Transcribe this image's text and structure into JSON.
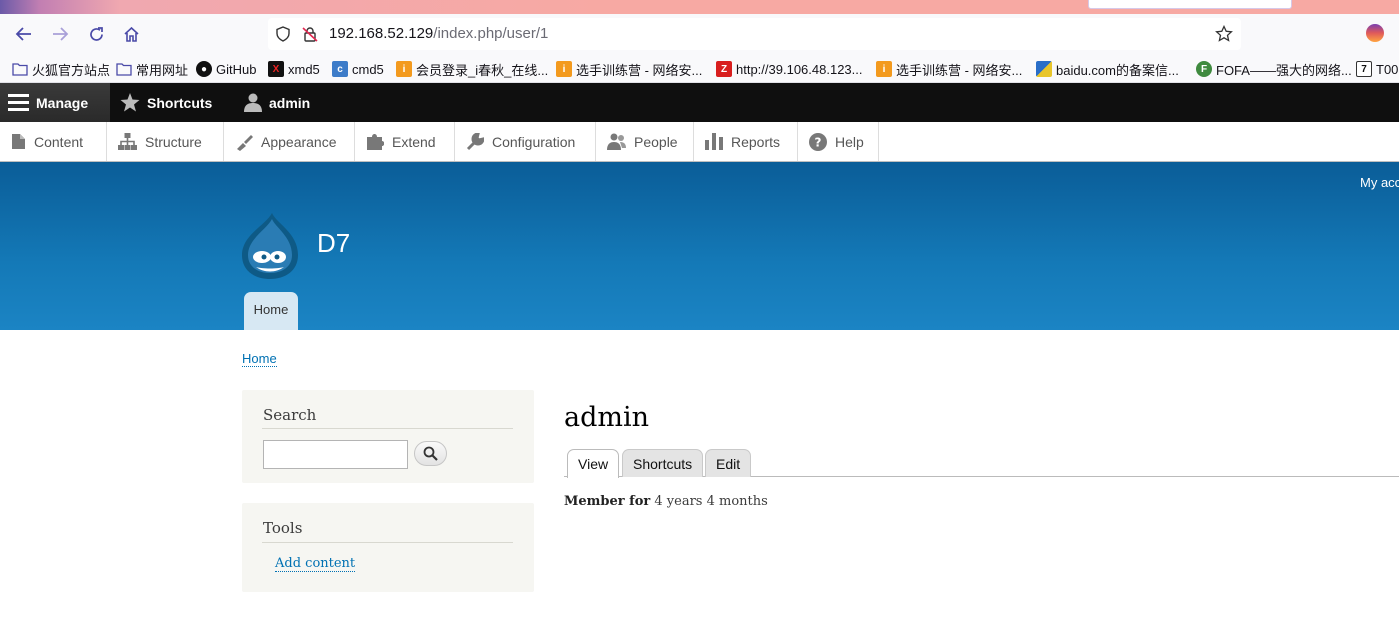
{
  "browser": {
    "url_host": "192.168.52.129",
    "url_path": "/index.php/user/1",
    "icons": [
      "back-arrow-icon",
      "forward-arrow-icon",
      "reload-icon",
      "home-icon",
      "shield-icon",
      "insecure-lock-icon",
      "bookmark-star-icon"
    ],
    "bookmarks": [
      {
        "label": "火狐官方站点",
        "icon": "folder-icon"
      },
      {
        "label": "常用网址",
        "icon": "folder-icon"
      },
      {
        "label": "GitHub",
        "icon": "github-icon"
      },
      {
        "label": "xmd5",
        "icon": "xmd5-icon"
      },
      {
        "label": "cmd5",
        "icon": "cmd5-icon"
      },
      {
        "label": "会员登录_i春秋_在线...",
        "icon": "ichunqiu-icon"
      },
      {
        "label": "选手训练营 - 网络安...",
        "icon": "ichunqiu-icon"
      },
      {
        "label": "http://39.106.48.123...",
        "icon": "z-icon"
      },
      {
        "label": "选手训练营 - 网络安...",
        "icon": "ichunqiu-icon"
      },
      {
        "label": "baidu.com的备案信...",
        "icon": "baidu-icon"
      },
      {
        "label": "FOFA——强大的网络...",
        "icon": "fofa-icon"
      },
      {
        "label": "T00",
        "icon": "t00-icon"
      }
    ]
  },
  "toolbar": {
    "manage": "Manage",
    "shortcuts": "Shortcuts",
    "user": "admin"
  },
  "tray": [
    "Content",
    "Structure",
    "Appearance",
    "Extend",
    "Configuration",
    "People",
    "Reports",
    "Help"
  ],
  "header": {
    "my_account": "My acc",
    "site_name": "D7",
    "home_tab": "Home",
    "colors": {
      "header_top": "#0a5d98",
      "header_bottom": "#1b84c4"
    }
  },
  "breadcrumb": "Home",
  "sidebar": {
    "search_title": "Search",
    "search_value": "",
    "tools_title": "Tools",
    "add_content": "Add content"
  },
  "main": {
    "title": "admin",
    "tabs": [
      "View",
      "Shortcuts",
      "Edit"
    ],
    "active_tab": "View",
    "member_label": "Member for",
    "member_value": "4 years 4 months"
  }
}
